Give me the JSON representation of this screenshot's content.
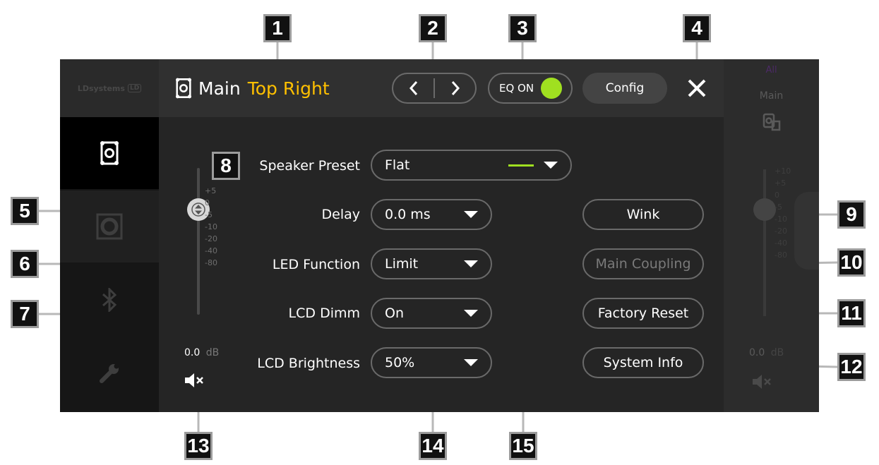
{
  "brand": {
    "text": "LDsystems",
    "badge": "LD"
  },
  "header": {
    "title_main": "Main",
    "title_accent": "Top Right",
    "eq_label": "EQ ON",
    "config_label": "Config"
  },
  "sidebar": {
    "items": [
      {
        "icon": "speaker-icon",
        "active": true
      },
      {
        "icon": "subwoofer-icon",
        "active": false
      },
      {
        "icon": "bluetooth-icon",
        "active": false
      },
      {
        "icon": "wrench-icon",
        "active": false
      }
    ]
  },
  "fader": {
    "scale": [
      "+5",
      "0",
      "-5",
      "-10",
      "-20",
      "-40",
      "-80"
    ],
    "level_value": "0.0",
    "level_unit": "dB"
  },
  "settings": {
    "speaker_preset": {
      "label": "Speaker Preset",
      "value": "Flat",
      "preset_color": "#a0e020"
    },
    "delay": {
      "label": "Delay",
      "value": "0.0 ms"
    },
    "led_function": {
      "label": "LED Function",
      "value": "Limit"
    },
    "lcd_dimm": {
      "label": "LCD Dimm",
      "value": "On"
    },
    "lcd_brightness": {
      "label": "LCD Brightness",
      "value": "50%"
    }
  },
  "actions": {
    "wink": "Wink",
    "main_coupling": "Main Coupling",
    "factory_reset": "Factory Reset",
    "system_info": "System Info"
  },
  "right_panel": {
    "group_label": "All",
    "channel_label": "Main",
    "scale": [
      "+10",
      "+5",
      "0",
      "-5",
      "-10",
      "-20",
      "-40",
      "-80"
    ],
    "level_value": "0.0",
    "level_unit": "dB"
  },
  "callouts": [
    "1",
    "2",
    "3",
    "4",
    "5",
    "6",
    "7",
    "8",
    "9",
    "10",
    "11",
    "12",
    "13",
    "14",
    "15"
  ],
  "colors": {
    "accent": "#ffc000",
    "eq_on": "#a0e020",
    "background": "#252525"
  }
}
